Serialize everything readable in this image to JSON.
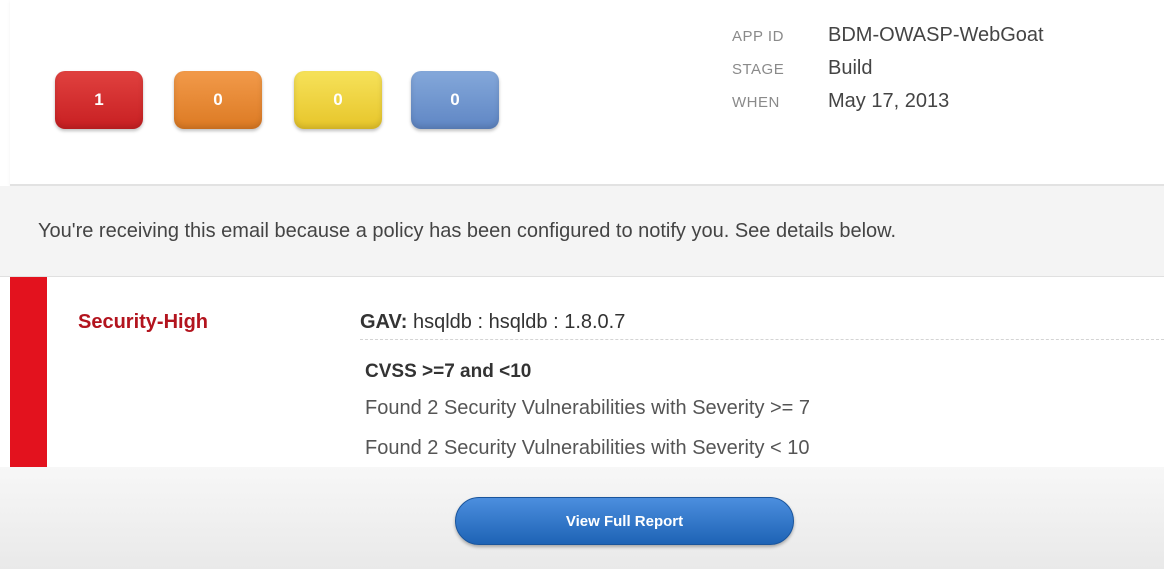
{
  "summary": {
    "critical_count": "1",
    "severe_count": "0",
    "moderate_count": "0",
    "low_count": "0",
    "colors": {
      "critical": "#d9302f",
      "severe": "#e98a35",
      "moderate": "#f0d63f",
      "low": "#7099d2"
    }
  },
  "meta": {
    "app_id_label": "APP ID",
    "app_id_value": "BDM-OWASP-WebGoat",
    "stage_label": "STAGE",
    "stage_value": "Build",
    "when_label": "WHEN",
    "when_value": "May 17, 2013"
  },
  "notice": {
    "text": "You're receiving this email because a policy has been configured to notify you. See details below."
  },
  "violation": {
    "threat": "Security-High",
    "threat_color": "#e3121e",
    "gav_label": "GAV:",
    "gav_value": " hsqldb : hsqldb : 1.8.0.7",
    "constraint": "CVSS >=7 and <10",
    "conditions": [
      "Found 2 Security Vulnerabilities with Severity >= 7",
      "Found 2 Security Vulnerabilities with Severity < 10"
    ]
  },
  "footer": {
    "button_label": "View Full Report",
    "button_color": "#2a6fc3"
  }
}
